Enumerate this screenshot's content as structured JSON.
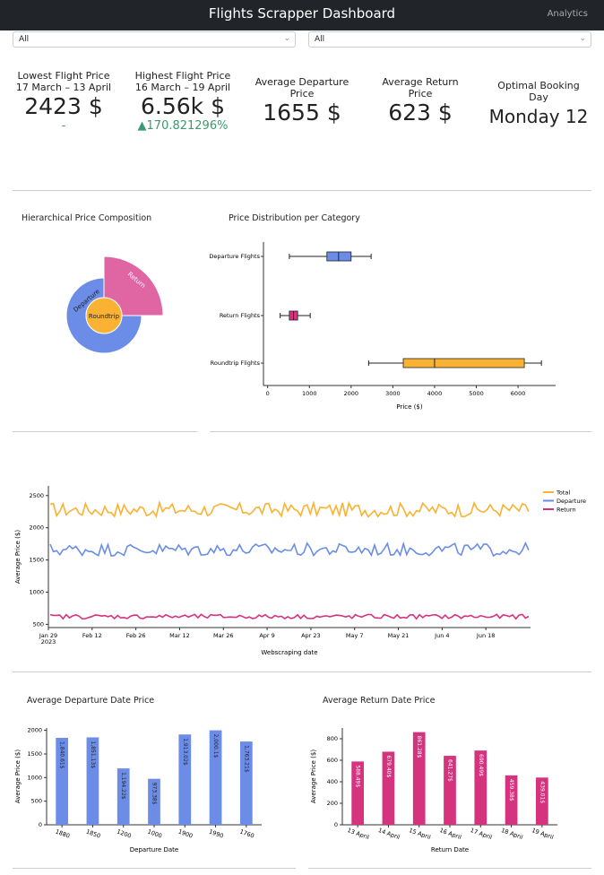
{
  "header": {
    "title": "Flights Scrapper Dashboard",
    "nav": "Analytics"
  },
  "filters": [
    {
      "value": "All"
    },
    {
      "value": "All"
    }
  ],
  "kpis": {
    "lowest": {
      "label": "Lowest Flight Price",
      "dates": "17 March – 13 April",
      "value": "2423 $",
      "delta": "-"
    },
    "highest": {
      "label": "Highest Flight Price",
      "dates": "16 March – 19 April",
      "value": "6.56k $",
      "delta": "▲170.821296%"
    },
    "avg_departure": {
      "label1": "Average Departure",
      "label2": "Price",
      "value": "1655 $"
    },
    "avg_return": {
      "label1": "Average Return",
      "label2": "Price",
      "value": "623 $"
    },
    "optimal": {
      "label1": "Optimal Booking",
      "label2": "Day",
      "value": "Monday 12"
    }
  },
  "sunburst": {
    "title": "Hierarchical Price Composition",
    "labels": [
      "Roundtrip",
      "Departure",
      "Return"
    ],
    "colors": {
      "Roundtrip": "#f9b233",
      "Departure": "#6b8de8",
      "Return": "#e066a3"
    }
  },
  "chart_data": [
    {
      "type": "box",
      "title": "Price Distribution per Category",
      "xlabel": "Price ($)",
      "xticks": [
        0,
        1000,
        2000,
        3000,
        4000,
        5000,
        6000
      ],
      "xlim": [
        -100,
        6900
      ],
      "series": [
        {
          "name": "Departure Flights",
          "min": 520,
          "q1": 1420,
          "median": 1700,
          "q3": 2000,
          "max": 2480,
          "color": "#6b8de8"
        },
        {
          "name": "Return Flights",
          "min": 300,
          "q1": 520,
          "median": 620,
          "q3": 720,
          "max": 1020,
          "color": "#d6337f"
        },
        {
          "name": "Roundtrip Flights",
          "min": 2420,
          "q1": 3250,
          "median": 4000,
          "q3": 6150,
          "max": 6560,
          "color": "#f9b233"
        }
      ]
    },
    {
      "type": "line",
      "xlabel": "Webscraping date",
      "ylabel": "Average Price ($)",
      "xticks": [
        "Jan 29\n2023",
        "Feb 12",
        "Feb 26",
        "Mar 12",
        "Mar 26",
        "Apr 9",
        "Apr 23",
        "May 7",
        "May 21",
        "Jun 4",
        "Jun 18"
      ],
      "yticks": [
        500,
        1000,
        1500,
        2000,
        2500
      ],
      "ylim": [
        450,
        2650
      ],
      "series": [
        {
          "name": "Total",
          "base": 2280,
          "amp": 110,
          "color": "#f9b233"
        },
        {
          "name": "Departure",
          "base": 1660,
          "amp": 100,
          "color": "#6b8de8"
        },
        {
          "name": "Return",
          "base": 620,
          "amp": 35,
          "color": "#d6337f"
        }
      ]
    },
    {
      "type": "bar",
      "title": "Average Departure Date Price",
      "xlabel": "Departure Date",
      "ylabel": "Average Price ($)",
      "ylim": [
        0,
        2050
      ],
      "yticks": [
        0,
        500,
        1000,
        1500,
        2000
      ],
      "categories": [
        "1880",
        "1850",
        "1200",
        "1000",
        "1900",
        "1990",
        "1760"
      ],
      "values": [
        1840.61,
        1851.14,
        1194.22,
        973.38,
        1913.02,
        2000.1,
        1763.21
      ],
      "labels": [
        "1,840.61$",
        "1,851.13$",
        "1,194.22$",
        "973.38$",
        "1,913.02$",
        "2,000.1$",
        "1,763.21$"
      ],
      "color": "#6b8de8"
    },
    {
      "type": "bar",
      "title": "Average Return Date Price",
      "xlabel": "Return Date",
      "ylabel": "Average Price ($)",
      "ylim": [
        0,
        900
      ],
      "yticks": [
        0,
        200,
        400,
        600,
        800
      ],
      "categories": [
        "13 April",
        "14 April",
        "15 April",
        "16 April",
        "17 April",
        "18 April",
        "19 April"
      ],
      "values": [
        588.49,
        679.4,
        861.28,
        641.27,
        690.49,
        459.38,
        439.01
      ],
      "labels": [
        "588.49$",
        "679.40$",
        "861.28$",
        "641.27$",
        "690.49$",
        "459.38$",
        "439.01$"
      ],
      "color": "#d6337f"
    }
  ]
}
